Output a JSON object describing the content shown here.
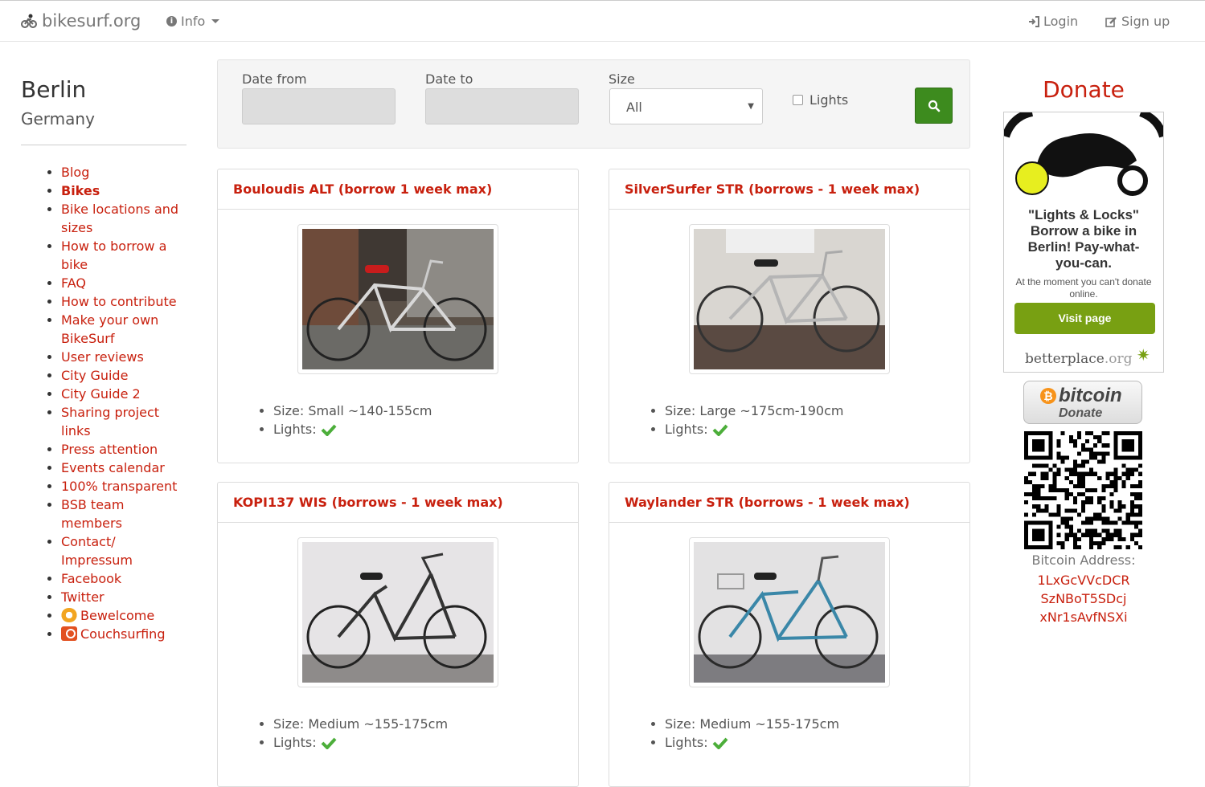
{
  "nav": {
    "brand": "bikesurf.org",
    "info": "Info",
    "login": "Login",
    "signup": "Sign up"
  },
  "sidebar": {
    "city": "Berlin",
    "country": "Germany",
    "items": [
      {
        "label": "Blog"
      },
      {
        "label": "Bikes",
        "active": true
      },
      {
        "label": "Bike locations and sizes"
      },
      {
        "label": "How to borrow a bike"
      },
      {
        "label": "FAQ"
      },
      {
        "label": "How to contribute"
      },
      {
        "label": "Make your own BikeSurf"
      },
      {
        "label": "User reviews"
      },
      {
        "label": "City Guide"
      },
      {
        "label": "City Guide 2"
      },
      {
        "label": "Sharing project links"
      },
      {
        "label": "Press attention"
      },
      {
        "label": "Events calendar"
      },
      {
        "label": "100% transparent"
      },
      {
        "label": "BSB team members"
      },
      {
        "label": "Contact/ Impressum"
      },
      {
        "label": "Facebook"
      },
      {
        "label": "Twitter"
      },
      {
        "label": "Bewelcome",
        "icon": "bewelcome-icon"
      },
      {
        "label": "Couchsurfing",
        "icon": "couchsurfing-icon"
      }
    ]
  },
  "search": {
    "date_from_label": "Date from",
    "date_to_label": "Date to",
    "size_label": "Size",
    "size_value": "All",
    "lights_label": "Lights",
    "lights_checked": false
  },
  "bikes": [
    {
      "title": "Bouloudis ALT (borrow 1 week max)",
      "size": "Size: Small ~140-155cm",
      "lights": "Lights:"
    },
    {
      "title": "SilverSurfer STR (borrows - 1 week max)",
      "size": "Size: Large ~175cm-190cm",
      "lights": "Lights:"
    },
    {
      "title": "KOPI137 WIS (borrows - 1 week max)",
      "size": "Size: Medium ~155-175cm",
      "lights": "Lights:"
    },
    {
      "title": "Waylander STR (borrows - 1 week max)",
      "size": "Size: Medium ~155-175cm",
      "lights": "Lights:"
    }
  ],
  "donate": {
    "title": "Donate",
    "bp_title": "\"Lights & Locks\" Borrow a bike in Berlin! Pay-what-you-can.",
    "bp_note": "At the moment you can't donate online.",
    "bp_visit": "Visit page",
    "bp_brand_main": "betterplace",
    "bp_brand_org": ".org",
    "btc_word": "bitcoin",
    "btc_donate": "Donate",
    "btc_label": "Bitcoin Address:",
    "btc_address": [
      "1LxGcVVcDCR",
      "SzNBoT5SDcj",
      "xNr1sAvfNSXi"
    ]
  },
  "colors": {
    "link": "#c8200e",
    "search_button": "#3d8b1e",
    "visit_button": "#78a012"
  }
}
